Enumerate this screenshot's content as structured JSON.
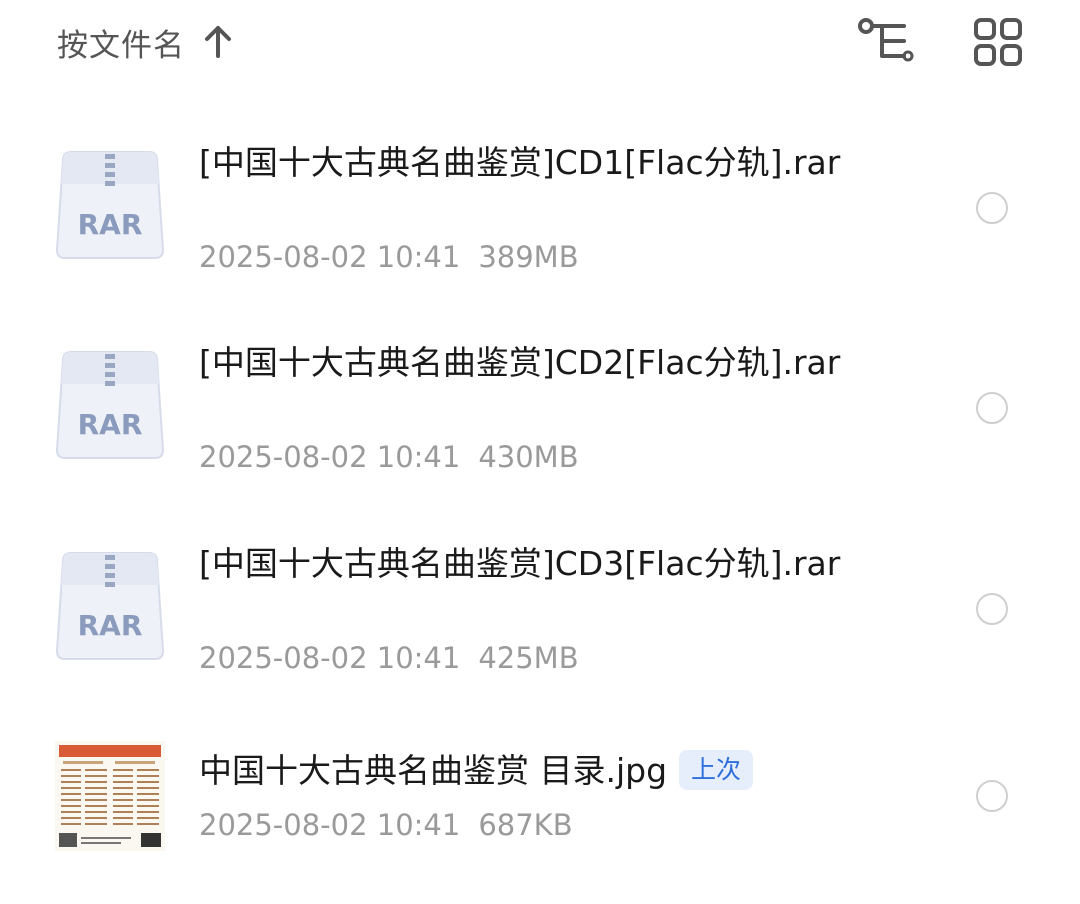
{
  "header": {
    "sort_label": "按文件名",
    "sort_icon": "arrow-up-icon",
    "tree_icon": "tree-view-icon",
    "grid_icon": "grid-view-icon"
  },
  "files": [
    {
      "name": "[中国十大古典名曲鉴赏]CD1[Flac分轨].rar",
      "date": "2025-08-02 10:41",
      "size": "389MB",
      "type_label": "RAR",
      "icon": "rar-archive-icon"
    },
    {
      "name": "[中国十大古典名曲鉴赏]CD2[Flac分轨].rar",
      "date": "2025-08-02 10:41",
      "size": "430MB",
      "type_label": "RAR",
      "icon": "rar-archive-icon"
    },
    {
      "name": "[中国十大古典名曲鉴赏]CD3[Flac分轨].rar",
      "date": "2025-08-02 10:41",
      "size": "425MB",
      "type_label": "RAR",
      "icon": "rar-archive-icon"
    },
    {
      "name": "中国十大古典名曲鉴赏 目录.jpg",
      "date": "2025-08-02 10:41",
      "size": "687KB",
      "badge": "上次",
      "icon": "image-thumbnail"
    }
  ],
  "colors": {
    "accent": "#2f6fdc",
    "badge_bg": "#e6eefc",
    "rar_icon": "#8a9bbd",
    "meta_text": "#9a9a9a"
  }
}
